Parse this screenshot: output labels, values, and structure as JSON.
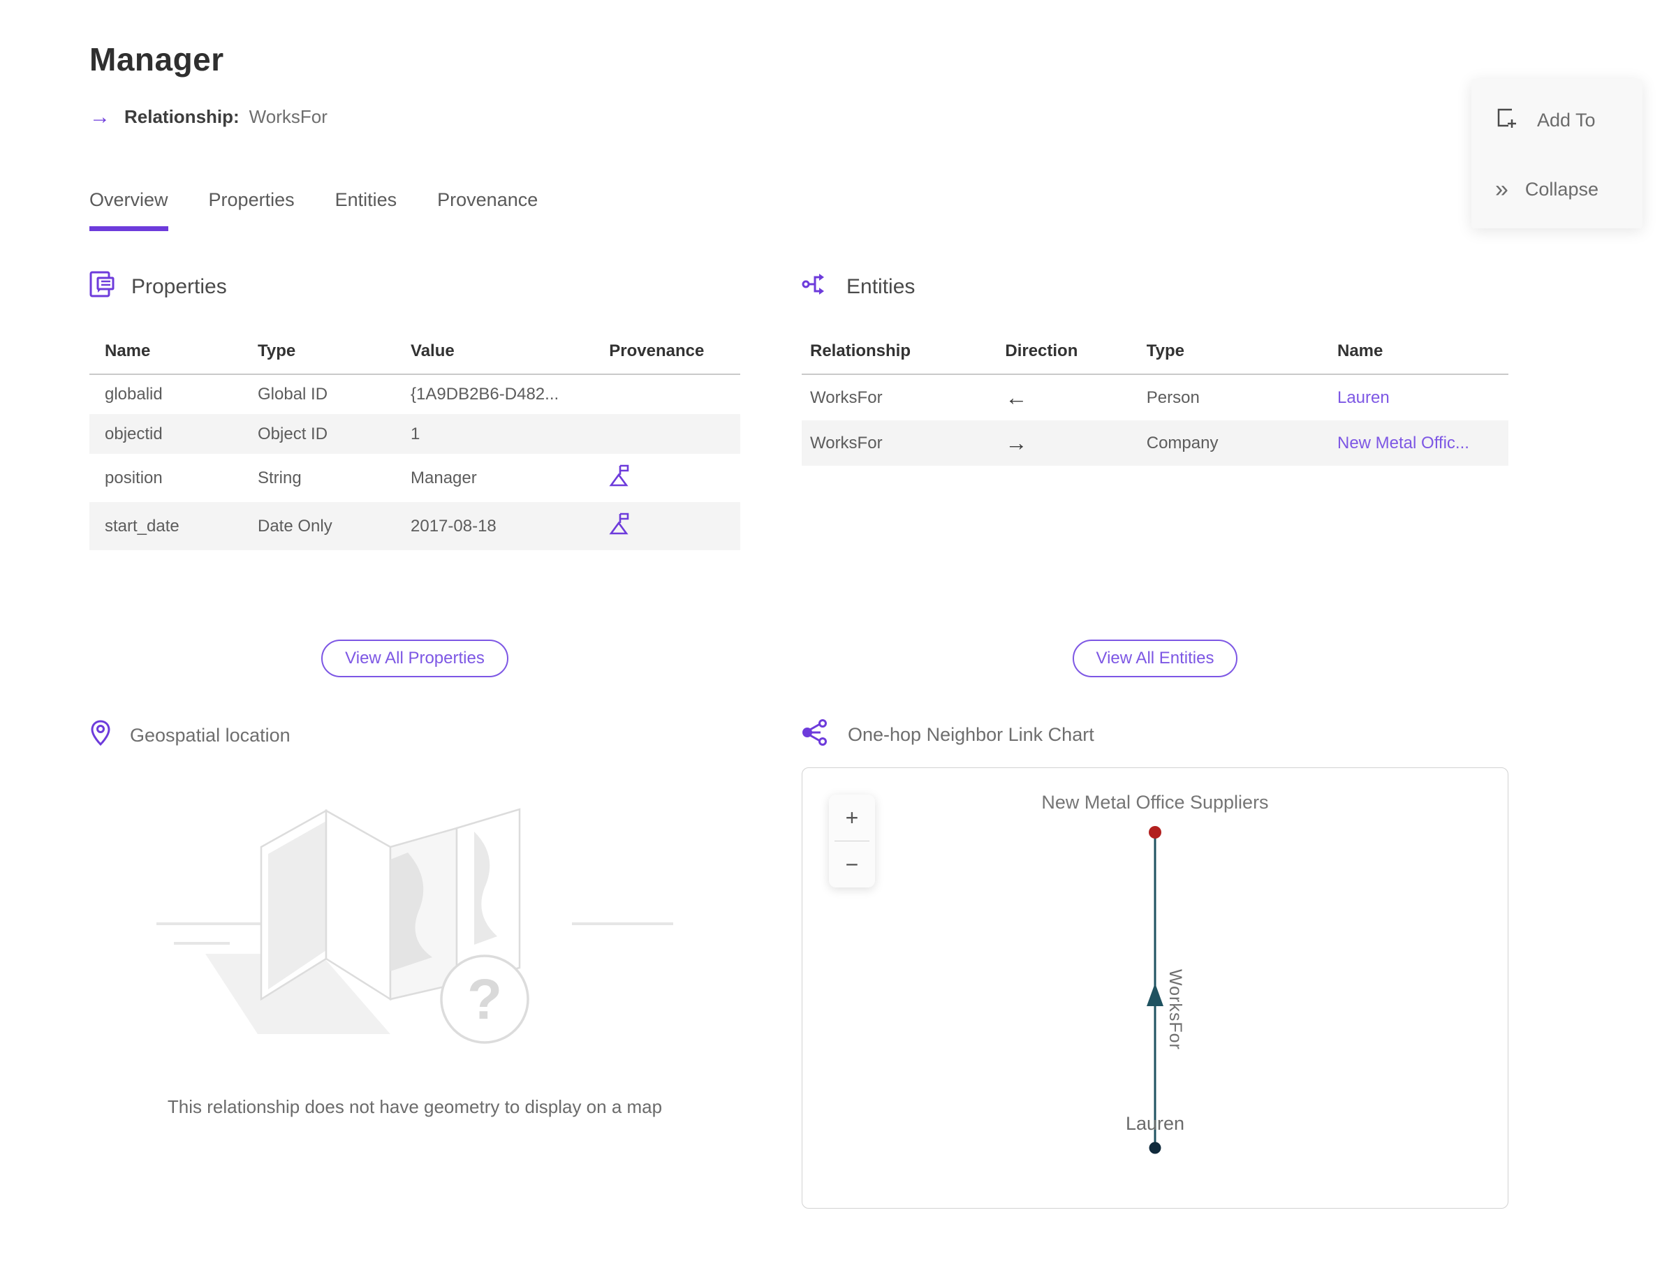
{
  "page": {
    "title": "Manager",
    "subtitle_arrow": "→",
    "subtitle_label": "Relationship:",
    "subtitle_value": "WorksFor"
  },
  "actions": {
    "add_to": "Add To",
    "collapse": "Collapse",
    "collapse_glyph": "»"
  },
  "tabs": [
    {
      "label": "Overview",
      "active": true
    },
    {
      "label": "Properties",
      "active": false
    },
    {
      "label": "Entities",
      "active": false
    },
    {
      "label": "Provenance",
      "active": false
    }
  ],
  "properties_section": {
    "title": "Properties",
    "columns": {
      "name": "Name",
      "type": "Type",
      "value": "Value",
      "provenance": "Provenance"
    },
    "rows": [
      {
        "name": "globalid",
        "type": "Global ID",
        "value": "{1A9DB2B6-D482...",
        "provenance": false
      },
      {
        "name": "objectid",
        "type": "Object ID",
        "value": "1",
        "provenance": false
      },
      {
        "name": "position",
        "type": "String",
        "value": "Manager",
        "provenance": true
      },
      {
        "name": "start_date",
        "type": "Date Only",
        "value": "2017-08-18",
        "provenance": true
      }
    ],
    "view_all_label": "View All Properties"
  },
  "entities_section": {
    "title": "Entities",
    "columns": {
      "relationship": "Relationship",
      "direction": "Direction",
      "type": "Type",
      "name": "Name"
    },
    "rows": [
      {
        "relationship": "WorksFor",
        "direction": "←",
        "type": "Person",
        "name": "Lauren"
      },
      {
        "relationship": "WorksFor",
        "direction": "→",
        "type": "Company",
        "name": "New Metal Offic..."
      }
    ],
    "view_all_label": "View All Entities"
  },
  "geospatial_section": {
    "title": "Geospatial location",
    "empty_message": "This relationship does not have geometry to display on a map"
  },
  "link_chart_section": {
    "title": "One-hop Neighbor Link Chart",
    "zoom_in": "+",
    "zoom_out": "−",
    "top_node": {
      "label": "New Metal Office Suppliers",
      "color": "#b2201f"
    },
    "bottom_node": {
      "label": "Lauren",
      "color": "#102a3c"
    },
    "edge_label": "WorksFor",
    "edge_color": "#1f5260"
  },
  "colors": {
    "accent_purple": "#6d3bdb",
    "link_purple": "#7d57e4",
    "alt_row": "#f4f4f4"
  }
}
